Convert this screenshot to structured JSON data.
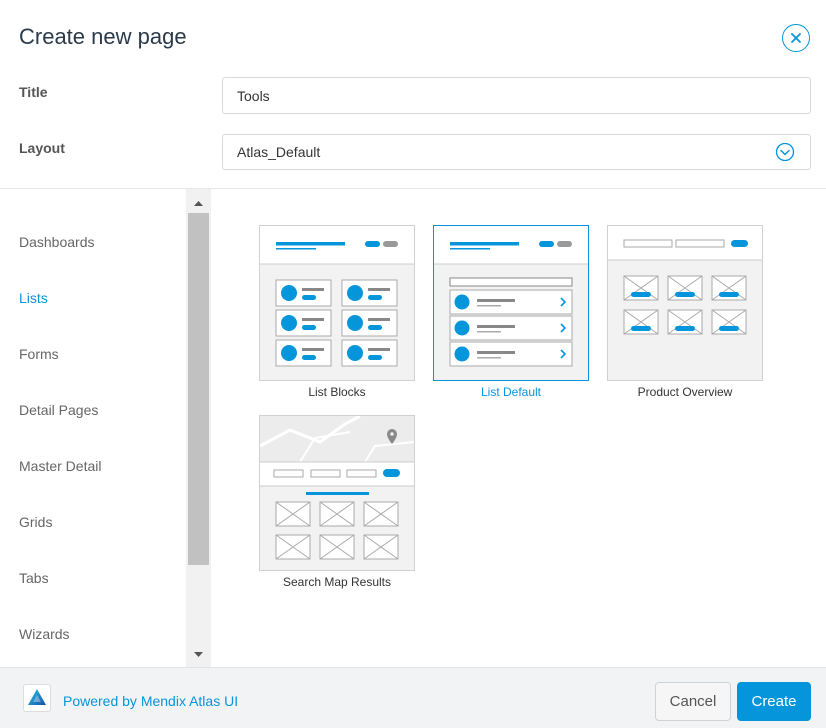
{
  "dialog": {
    "title": "Create new page"
  },
  "form": {
    "title_label": "Title",
    "title_value": "Tools",
    "layout_label": "Layout",
    "layout_value": "Atlas_Default"
  },
  "sidebar": {
    "items": [
      {
        "label": "Dashboards",
        "active": false
      },
      {
        "label": "Lists",
        "active": true
      },
      {
        "label": "Forms",
        "active": false
      },
      {
        "label": "Detail Pages",
        "active": false
      },
      {
        "label": "Master Detail",
        "active": false
      },
      {
        "label": "Grids",
        "active": false
      },
      {
        "label": "Tabs",
        "active": false
      },
      {
        "label": "Wizards",
        "active": false
      }
    ]
  },
  "templates": [
    {
      "label": "List Blocks",
      "selected": false,
      "icon": "list-blocks-thumbnail"
    },
    {
      "label": "List Default",
      "selected": true,
      "icon": "list-default-thumbnail"
    },
    {
      "label": "Product Overview",
      "selected": false,
      "icon": "product-overview-thumbnail"
    },
    {
      "label": "Search Map Results",
      "selected": false,
      "icon": "search-map-results-thumbnail"
    }
  ],
  "footer": {
    "powered_by": "Powered by Mendix Atlas UI",
    "cancel_label": "Cancel",
    "create_label": "Create"
  },
  "colors": {
    "accent": "#0595db",
    "thumb_bg": "#f2f2f2",
    "footer_bg": "#f2f3f4"
  }
}
